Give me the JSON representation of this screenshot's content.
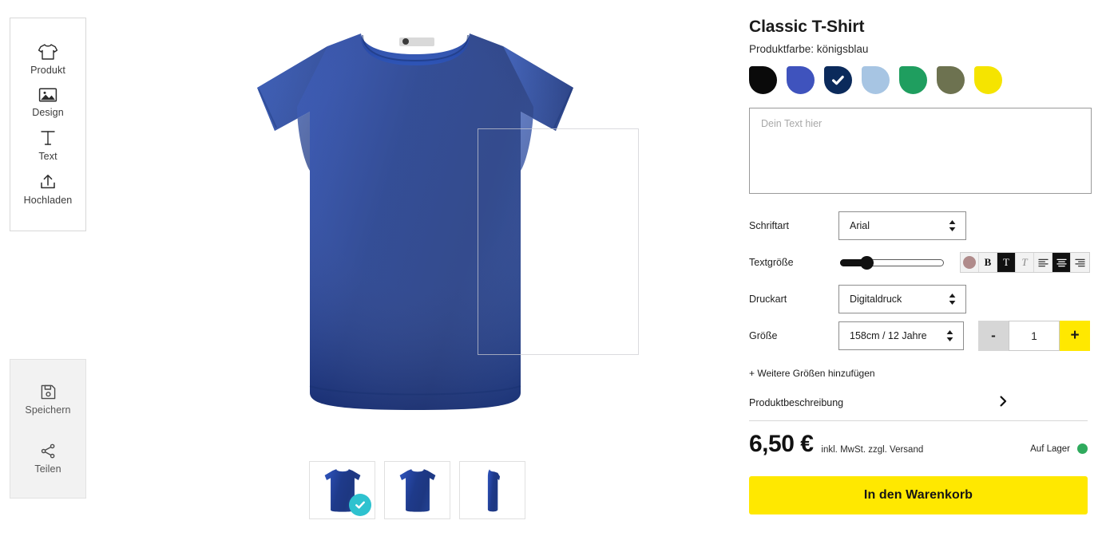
{
  "toolbar_left": {
    "primary_tools": [
      {
        "id": "produkt",
        "label": "Produkt",
        "icon": "tshirt-icon"
      },
      {
        "id": "design",
        "label": "Design",
        "icon": "image-icon"
      },
      {
        "id": "text",
        "label": "Text",
        "icon": "text-icon"
      },
      {
        "id": "hochladen",
        "label": "Hochladen",
        "icon": "upload-icon"
      }
    ],
    "secondary_tools": [
      {
        "id": "speichern",
        "label": "Speichern",
        "icon": "save-icon"
      },
      {
        "id": "teilen",
        "label": "Teilen",
        "icon": "share-icon"
      }
    ]
  },
  "canvas": {
    "product_color_hex": "#2b46a8",
    "print_area_visible": true,
    "thumbnails": [
      {
        "id": "front",
        "view": "Vorderansicht",
        "selected": true
      },
      {
        "id": "back",
        "view": "Rückansicht",
        "selected": false
      },
      {
        "id": "side",
        "view": "Seitenansicht",
        "selected": false
      }
    ],
    "selected_badge_color": "#2ec2cf"
  },
  "panel": {
    "title": "Classic T-Shirt",
    "color_line": "Produktfarbe: königsblau",
    "colors": [
      {
        "name": "schwarz",
        "hex": "#0a0a0a",
        "selected": false
      },
      {
        "name": "blau",
        "hex": "#3f53bd",
        "selected": false
      },
      {
        "name": "königsblau",
        "hex": "#0b2a5b",
        "selected": true
      },
      {
        "name": "hellblau",
        "hex": "#a7c5e3",
        "selected": false
      },
      {
        "name": "grün",
        "hex": "#1f9e5f",
        "selected": false
      },
      {
        "name": "oliv",
        "hex": "#6d7250",
        "selected": false
      },
      {
        "name": "gelb",
        "hex": "#f5e400",
        "selected": false
      }
    ],
    "text_input": {
      "value": "",
      "placeholder": "Dein Text hier"
    },
    "font": {
      "label": "Schriftart",
      "value": "Arial"
    },
    "text_size": {
      "label": "Textgröße",
      "percent": 22
    },
    "format_buttons": [
      {
        "id": "color",
        "glyph": "",
        "icon": "text-color-icon",
        "active": false,
        "swatch_hex": "#b08b8b"
      },
      {
        "id": "bold",
        "glyph": "B",
        "icon": "bold-icon",
        "active": false
      },
      {
        "id": "serif",
        "glyph": "T",
        "icon": "font-serif-icon",
        "active": true
      },
      {
        "id": "italic",
        "glyph": "T",
        "icon": "italic-icon",
        "active": false
      },
      {
        "id": "align-left",
        "glyph": "",
        "icon": "align-left-icon",
        "active": false
      },
      {
        "id": "align-center",
        "glyph": "",
        "icon": "align-center-icon",
        "active": true
      },
      {
        "id": "align-right",
        "glyph": "",
        "icon": "align-right-icon",
        "active": false
      }
    ],
    "print_type": {
      "label": "Druckart",
      "value": "Digitaldruck"
    },
    "size": {
      "label": "Größe",
      "value": "158cm / 12 Jahre"
    },
    "quantity": {
      "value": "1",
      "minus_label": "-",
      "plus_label": "+"
    },
    "add_sizes_link": "+ Weitere Größen hinzufügen",
    "description_accordion": {
      "label": "Produktbeschreibung",
      "caret": "›"
    },
    "price": {
      "amount": "6,50 €",
      "note": "inkl. MwSt. zzgl. Versand"
    },
    "stock": {
      "label": "Auf Lager",
      "dot_hex": "#2faa5d"
    },
    "cart_button": {
      "label": "In den Warenkorb",
      "bg_hex": "#ffe800"
    }
  }
}
